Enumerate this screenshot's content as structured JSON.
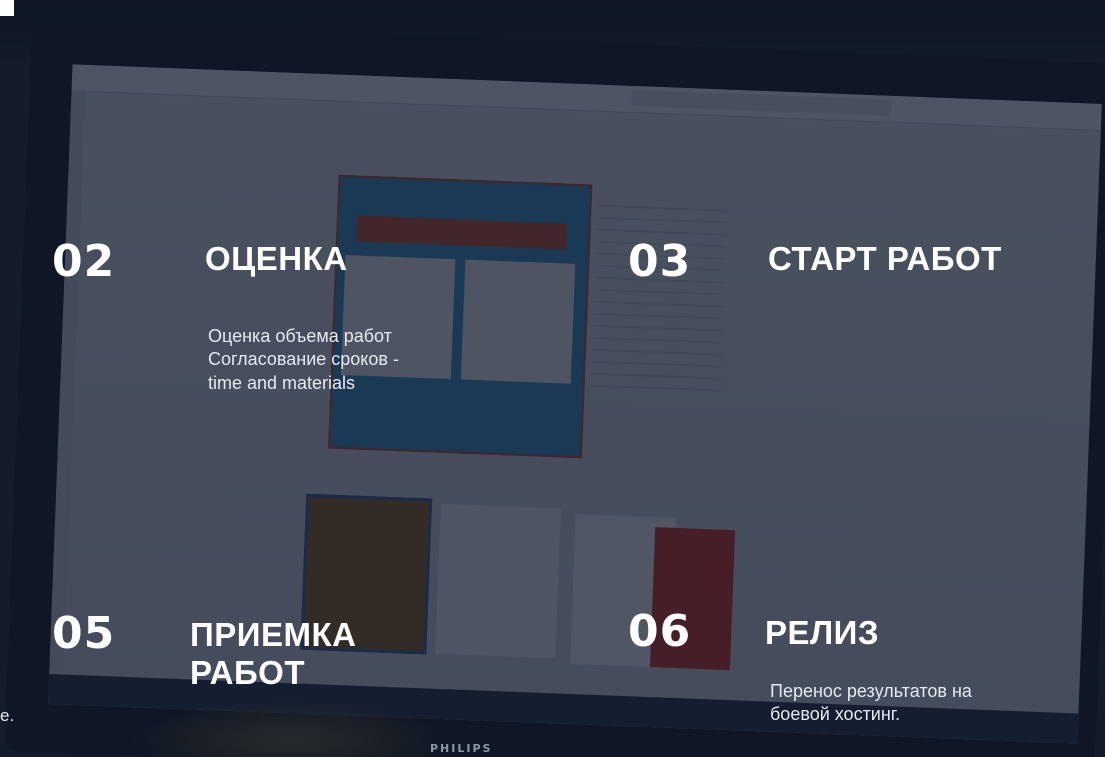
{
  "stages": [
    {
      "number": "02",
      "title": "ОЦЕНКА",
      "desc_lines": [
        "Оценка объема работ",
        "Согласование сроков -",
        "time and materials"
      ]
    },
    {
      "number": "03",
      "title": "СТАРТ РАБОТ",
      "desc_lines": []
    },
    {
      "number": "05",
      "title_lines": [
        "ПРИЕМКА",
        "РАБОТ"
      ],
      "desc_lines": []
    },
    {
      "number": "06",
      "title": "РЕЛИЗ",
      "desc_lines": [
        "Перенос результатов на",
        "боевой хостинг."
      ]
    }
  ],
  "cut_text": "е.",
  "monitor_brand": "PHILIPS"
}
